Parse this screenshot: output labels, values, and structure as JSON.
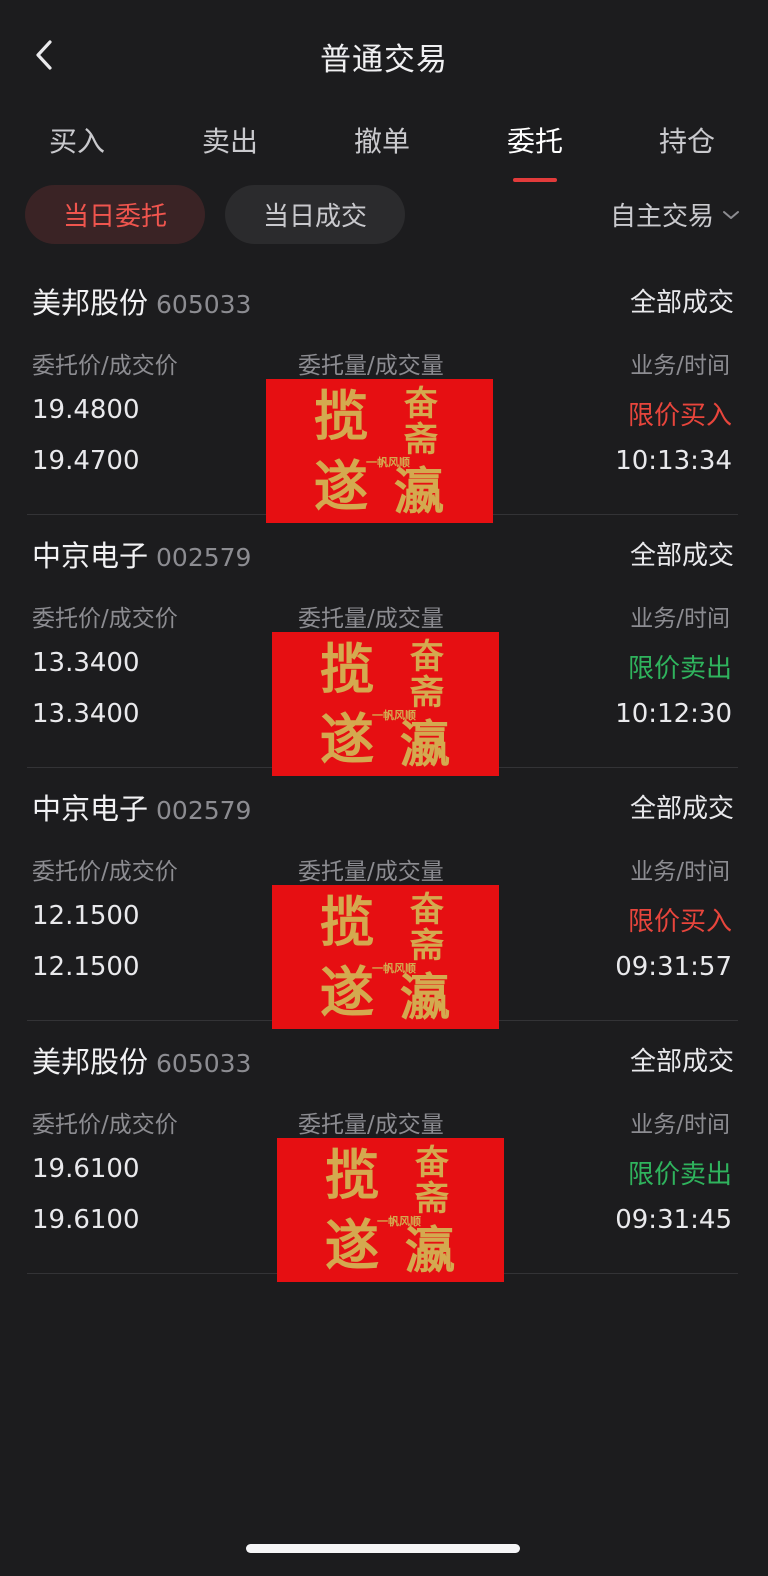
{
  "nav": {
    "title": "普通交易",
    "back_icon": "chevron-left-icon"
  },
  "tabs": [
    {
      "label": "买入",
      "active": false
    },
    {
      "label": "卖出",
      "active": false
    },
    {
      "label": "撤单",
      "active": false
    },
    {
      "label": "委托",
      "active": true
    },
    {
      "label": "持仓",
      "active": false
    }
  ],
  "filters": {
    "today_orders": "当日委托",
    "today_deals": "当日成交",
    "mode": "自主交易",
    "mode_icon": "chevron-down-icon"
  },
  "columns": {
    "price": "委托价/成交价",
    "qty": "委托量/成交量",
    "biz": "业务/时间"
  },
  "orders": [
    {
      "name": "美邦股份",
      "code": "605033",
      "status": "全部成交",
      "order_price": "19.4800",
      "deal_price": "19.4700",
      "biz": "限价买入",
      "side": "buy",
      "time": "10:13:34"
    },
    {
      "name": "中京电子",
      "code": "002579",
      "status": "全部成交",
      "order_price": "13.3400",
      "deal_price": "13.3400",
      "biz": "限价卖出",
      "side": "sell",
      "time": "10:12:30"
    },
    {
      "name": "中京电子",
      "code": "002579",
      "status": "全部成交",
      "order_price": "12.1500",
      "deal_price": "12.1500",
      "biz": "限价买入",
      "side": "buy",
      "time": "09:31:57"
    },
    {
      "name": "美邦股份",
      "code": "605033",
      "status": "全部成交",
      "order_price": "19.6100",
      "deal_price": "19.6100",
      "biz": "限价卖出",
      "side": "sell",
      "time": "09:31:45"
    }
  ],
  "stamp": {
    "lines": [
      "揽",
      "遂",
      "奋",
      "斋",
      "一帆风顺",
      "瀛"
    ],
    "bg_color": "#e60f12",
    "text_color": "#d4a94f"
  },
  "colors": {
    "background": "#1c1c1e",
    "buy": "#e8453c",
    "sell": "#2fb35d",
    "accent": "#e23b3b"
  }
}
